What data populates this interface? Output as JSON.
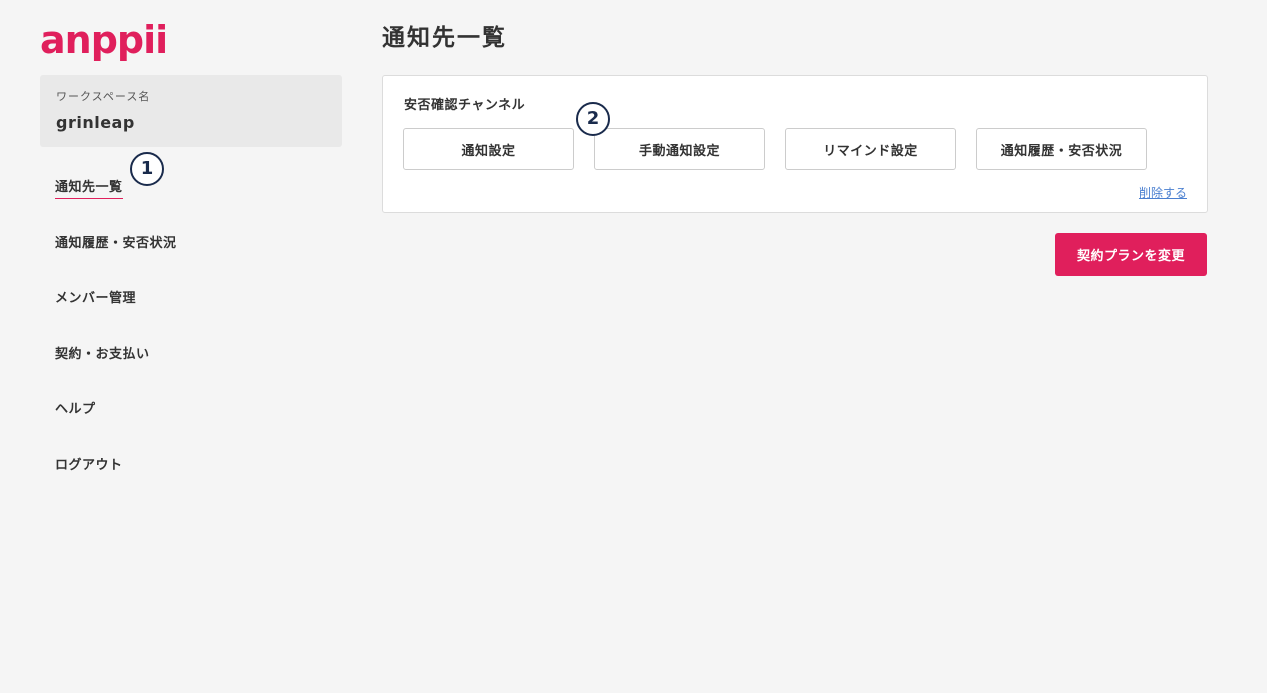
{
  "app": {
    "logo_text": "anppii",
    "brand_color": "#e01f5c"
  },
  "workspace": {
    "label": "ワークスペース名",
    "name": "grinleap"
  },
  "sidebar": {
    "items": [
      {
        "label": "通知先一覧",
        "active": true
      },
      {
        "label": "通知履歴・安否状況",
        "active": false
      },
      {
        "label": "メンバー管理",
        "active": false
      },
      {
        "label": "契約・お支払い",
        "active": false
      },
      {
        "label": "ヘルプ",
        "active": false
      },
      {
        "label": "ログアウト",
        "active": false
      }
    ]
  },
  "annotations": {
    "badge_1": "1",
    "badge_2": "2",
    "badge_color": "#1a2b4c"
  },
  "main": {
    "title": "通知先一覧",
    "channel": {
      "title": "安否確認チャンネル",
      "buttons": [
        {
          "label": "通知設定"
        },
        {
          "label": "手動通知設定"
        },
        {
          "label": "リマインド設定"
        },
        {
          "label": "通知履歴・安否状況"
        }
      ],
      "delete_label": "削除する"
    },
    "change_plan_label": "契約プランを変更"
  }
}
